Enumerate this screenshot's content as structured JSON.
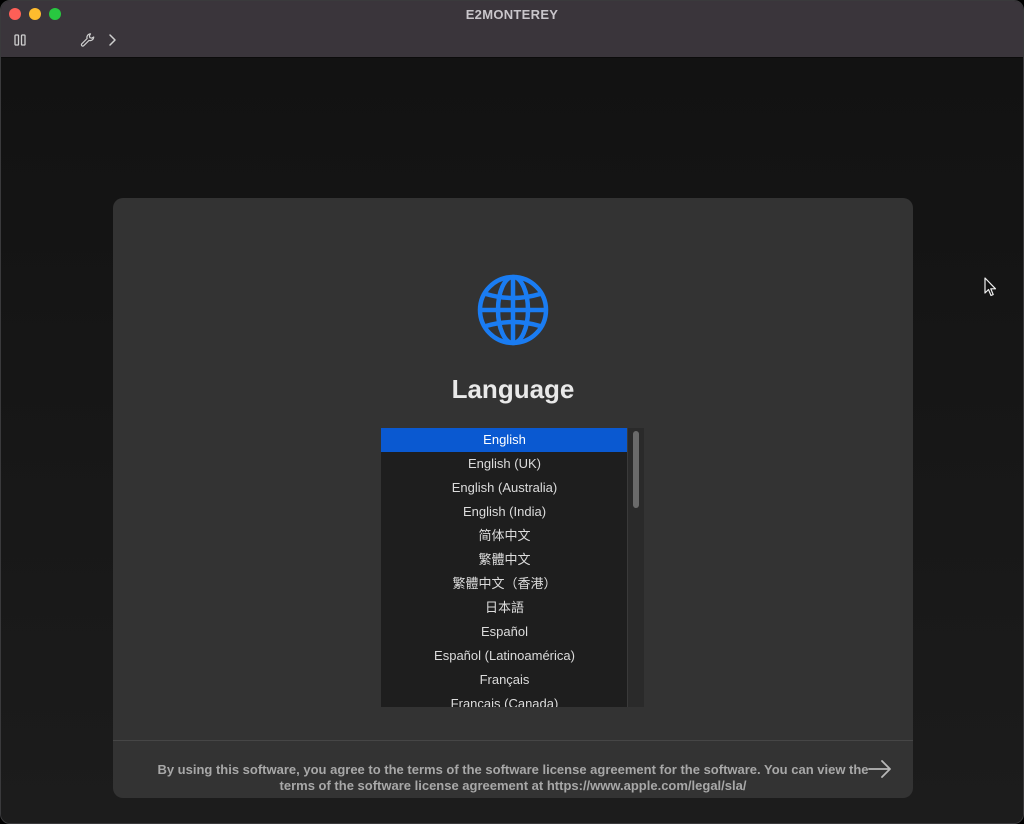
{
  "window": {
    "title": "E2MONTEREY"
  },
  "toolbar": {
    "icons": [
      "pause-icon",
      "wrench-icon",
      "chevron-right-icon"
    ]
  },
  "setup": {
    "heading": "Language",
    "icon": "globe-icon",
    "accent_color": "#1a7cf2",
    "selected_color": "#0a59d1",
    "languages": [
      "English",
      "English (UK)",
      "English (Australia)",
      "English (India)",
      "简体中文",
      "繁體中文",
      "繁體中文（香港）",
      "日本語",
      "Español",
      "Español (Latinoamérica)",
      "Français",
      "Français (Canada)"
    ],
    "selected_index": 0,
    "next_icon": "arrow-right-icon"
  },
  "footer": {
    "license_line1": "By using this software, you agree to the terms of the software license agreement for the software. You can view the",
    "license_line2": "terms of the software license agreement at https://www.apple.com/legal/sla/"
  }
}
